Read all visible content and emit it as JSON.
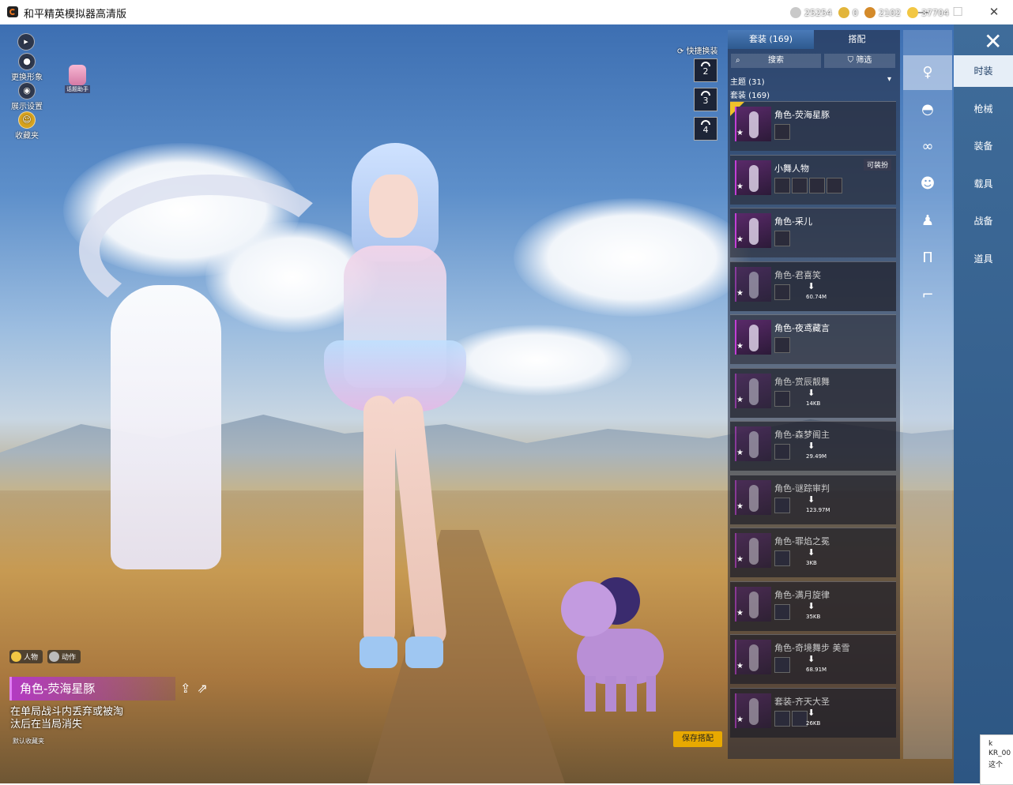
{
  "window": {
    "title": "和平精英模拟器高清版",
    "minimize": "—",
    "maximize": "☐",
    "close": "✕"
  },
  "hud": {
    "left_buttons": [
      {
        "label": "",
        "icon": "play-icon"
      },
      {
        "label": "更换形象",
        "icon": "person-icon"
      },
      {
        "label": "展示设置",
        "icon": "eye-icon"
      },
      {
        "label": "收藏夹",
        "icon": "badge-icon"
      }
    ],
    "helper_label": "话题助手",
    "quick_change_label": "快捷换装",
    "quick_slots": [
      "2",
      "3",
      "4"
    ]
  },
  "currency": [
    {
      "value": "25254",
      "color": "#c9c9c9"
    },
    {
      "value": "0",
      "color": "#e2b53b"
    },
    {
      "value": "2102",
      "color": "#d48a2a"
    },
    {
      "value": "37704",
      "color": "#f2c744"
    }
  ],
  "panel": {
    "tabs": [
      "套装 (169)",
      "搭配"
    ],
    "search_placeholder": "搜索",
    "filter_label": "筛选",
    "theme_label": "主题 (31)",
    "suits_label": "套装 (169)",
    "items": [
      {
        "name": "角色-荧海星豚",
        "locked": false,
        "selected": true,
        "size": "",
        "equip": "",
        "subs": 1
      },
      {
        "name": "小舞人物",
        "locked": false,
        "selected": false,
        "size": "",
        "equip": "可装扮",
        "subs": 4
      },
      {
        "name": "角色-采儿",
        "locked": false,
        "selected": false,
        "size": "",
        "equip": "",
        "subs": 1
      },
      {
        "name": "角色-君喜笑",
        "locked": true,
        "selected": false,
        "size": "60.74M",
        "equip": "",
        "subs": 1
      },
      {
        "name": "角色-夜鸢藏言",
        "locked": false,
        "selected": false,
        "size": "",
        "equip": "",
        "subs": 1
      },
      {
        "name": "角色-赏辰靓舞",
        "locked": true,
        "selected": false,
        "size": "14KB",
        "equip": "",
        "subs": 1
      },
      {
        "name": "角色-森梦阁主",
        "locked": true,
        "selected": false,
        "size": "29.49M",
        "equip": "",
        "subs": 1
      },
      {
        "name": "角色-谜踪审判",
        "locked": true,
        "selected": false,
        "size": "123.97M",
        "equip": "",
        "subs": 1
      },
      {
        "name": "角色-罪焰之冕",
        "locked": true,
        "selected": false,
        "size": "3KB",
        "equip": "",
        "subs": 1
      },
      {
        "name": "角色-满月旋律",
        "locked": true,
        "selected": false,
        "size": "35KB",
        "equip": "",
        "subs": 1
      },
      {
        "name": "角色-奇境舞步 美雪",
        "locked": true,
        "selected": false,
        "size": "68.91M",
        "equip": "",
        "subs": 1
      },
      {
        "name": "套装-齐天大圣",
        "locked": true,
        "selected": false,
        "size": "26KB",
        "equip": "",
        "subs": 2
      }
    ]
  },
  "parts": [
    "figure-icon",
    "hat-icon",
    "glasses-icon",
    "mask-icon",
    "outfit-icon",
    "pants-icon",
    "shoes-icon"
  ],
  "categories": [
    "时装",
    "枪械",
    "装备",
    "载具",
    "战备",
    "道具"
  ],
  "info": {
    "tabs": [
      "人物",
      "动作"
    ],
    "name": "角色-荧海星豚",
    "desc": "在单局战斗内丢弃或被淘汰后在当局消失",
    "default_fav": "默认收藏夹",
    "save_button": "保存搭配"
  },
  "corner_popup": {
    "line1": "k",
    "line2": "KR_00",
    "line3": "这个"
  }
}
